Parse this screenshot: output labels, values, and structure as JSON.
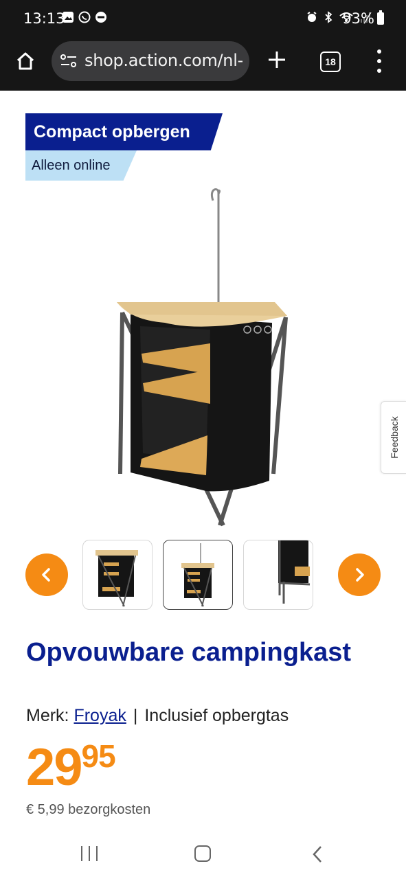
{
  "status_bar": {
    "time": "13:13",
    "battery": "93%"
  },
  "browser": {
    "url": "shop.action.com/nl-",
    "tab_count": "18"
  },
  "badges": {
    "primary": "Compact opbergen",
    "secondary": "Alleen online"
  },
  "product": {
    "title": "Opvouwbare campingkast",
    "brand_label": "Merk:",
    "brand_name": "Froyak",
    "separator": "|",
    "feature": "Inclusief opbergtas",
    "price_int": "29",
    "price_dec": "95",
    "shipping": "€ 5,99 bezorgkosten"
  },
  "feedback": {
    "label": "Feedback"
  },
  "colors": {
    "brand_blue": "#0a1f8f",
    "accent_orange": "#f58b14",
    "badge_light": "#bde0f5"
  },
  "icons": [
    "home-icon",
    "tune-icon",
    "plus-icon",
    "tabs-icon",
    "more-vert-icon",
    "chevron-left-icon",
    "chevron-right-icon"
  ]
}
